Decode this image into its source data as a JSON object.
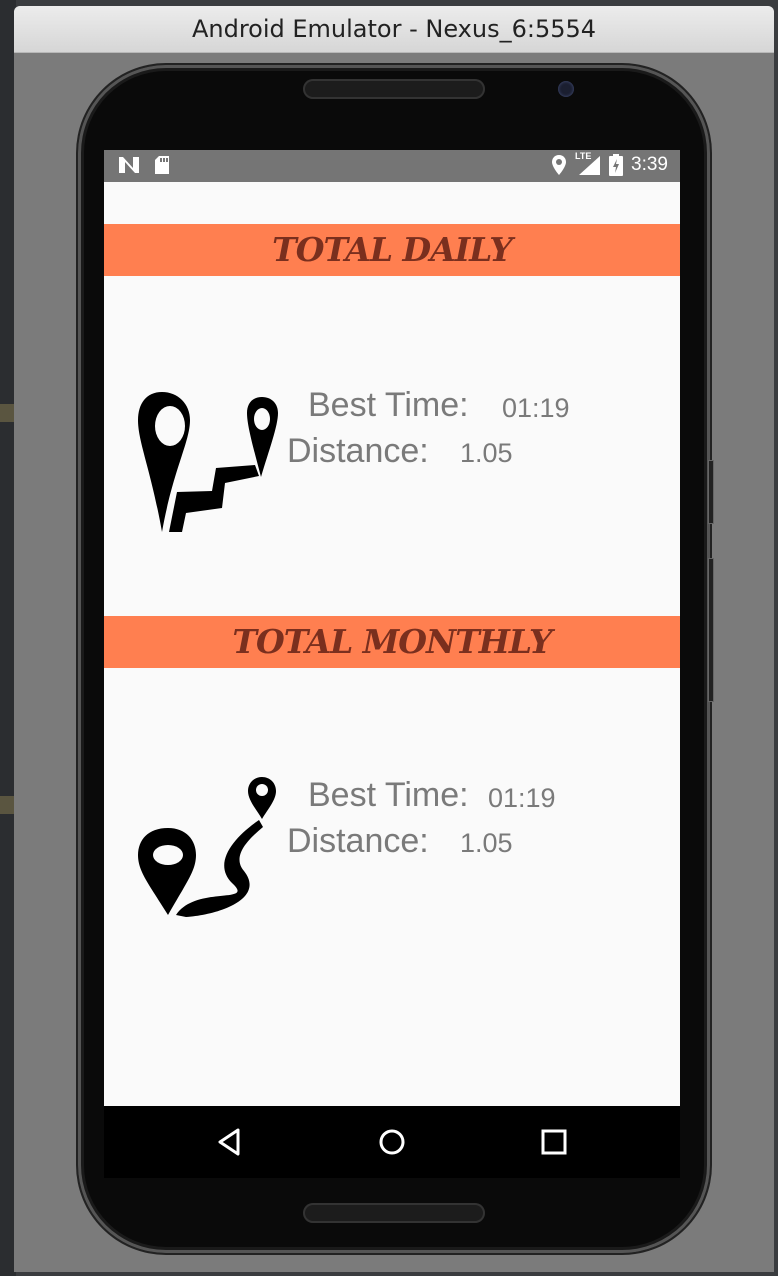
{
  "window": {
    "title": "Android Emulator - Nexus_6:5554"
  },
  "statusbar": {
    "left_icons": [
      "notification-n-icon",
      "sd-card-icon"
    ],
    "right_icons": [
      "location-icon",
      "lte-signal-icon",
      "battery-charging-icon"
    ],
    "network_label": "LTE",
    "time": "3:39"
  },
  "daily": {
    "title": "TOTAL DAILY",
    "best_time_label": "Best Time:",
    "best_time_value": "01:19",
    "distance_label": "Distance:",
    "distance_value": "1.05",
    "icon": "route-pins-icon"
  },
  "monthly": {
    "title": "TOTAL MONTHLY",
    "best_time_label": "Best Time:",
    "best_time_value": "01:19",
    "distance_label": "Distance:",
    "distance_value": "1.05",
    "icon": "winding-route-icon"
  },
  "navbar": {
    "buttons": [
      "back-icon",
      "home-icon",
      "recents-icon"
    ]
  },
  "colors": {
    "banner": "#ff7f50",
    "banner_text": "#7a2f1e",
    "label_text": "#7a7a7a",
    "statusbar": "#757575"
  }
}
